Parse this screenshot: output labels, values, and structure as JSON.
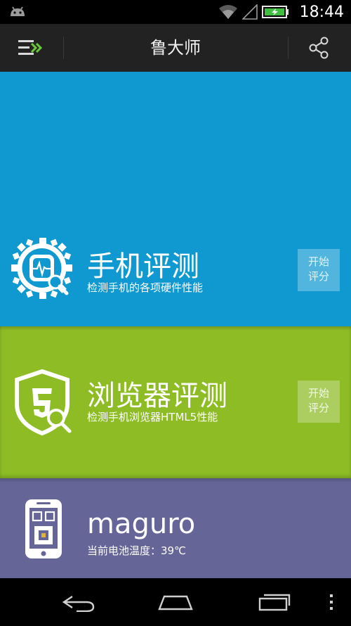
{
  "status_bar": {
    "time": "18:44",
    "icons": [
      "android-icon",
      "wifi-icon",
      "signal-icon",
      "battery-charging-icon"
    ]
  },
  "action_bar": {
    "title": "鲁大师",
    "left_icon": "menu-icon",
    "right_icon": "share-icon"
  },
  "cards": {
    "phone": {
      "title": "手机评测",
      "subtitle": "检测手机的各项硬件性能",
      "button_line1": "开始",
      "button_line2": "评分",
      "icon": "phone-benchmark-gear-icon",
      "color": "#0f99d0"
    },
    "browser": {
      "title": "浏览器评测",
      "subtitle": "检测手机浏览器HTML5性能",
      "button_line1": "开始",
      "button_line2": "评分",
      "icon": "html5-shield-search-icon",
      "color": "#8dbc25"
    },
    "device": {
      "title": "maguro",
      "subtitle": "当前电池温度：39℃",
      "icon": "smartphone-chip-icon",
      "color": "#656598"
    }
  },
  "nav_bar": {
    "icons": [
      "back-icon",
      "home-icon",
      "recents-icon",
      "overflow-menu-icon"
    ]
  }
}
